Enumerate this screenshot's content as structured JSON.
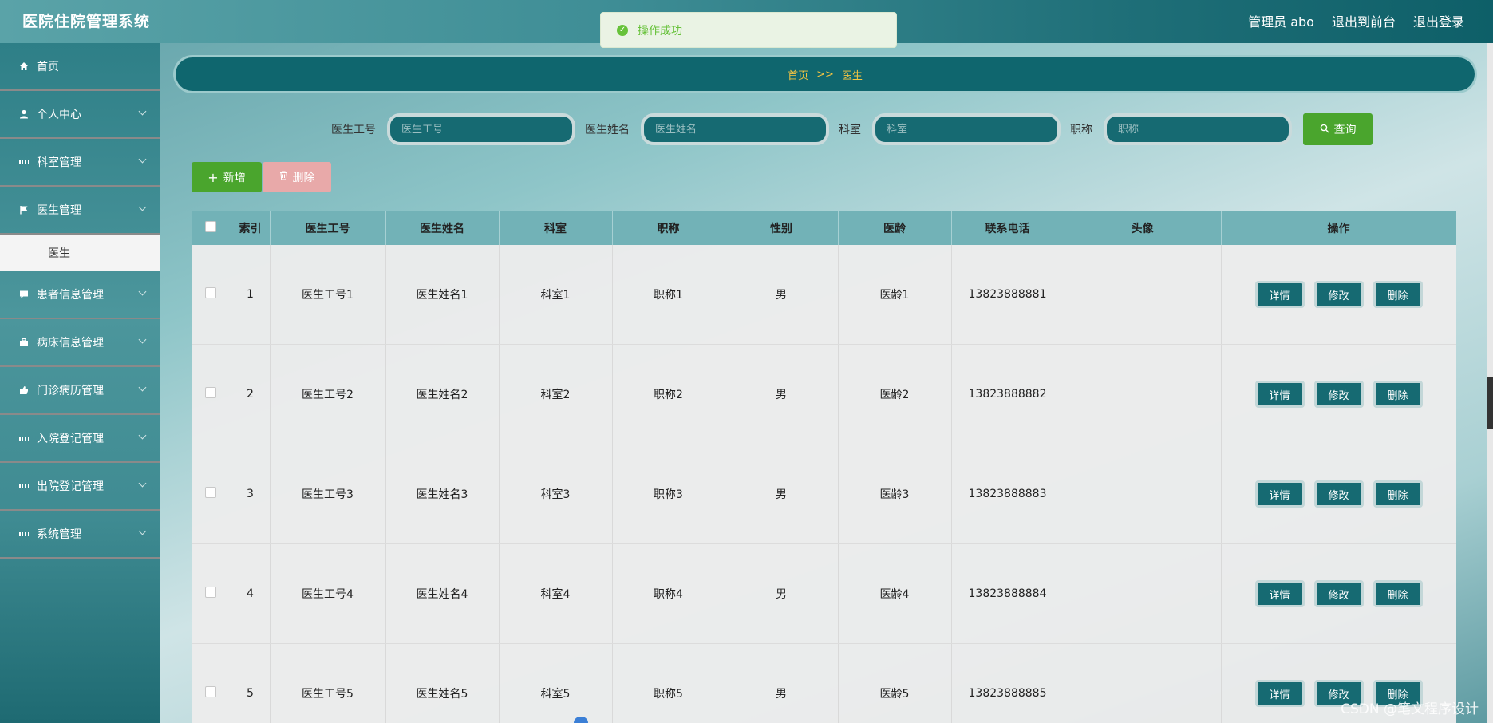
{
  "app": {
    "title": "医院住院管理系统"
  },
  "header": {
    "user_label": "管理员 abo",
    "back_front": "退出到前台",
    "logout": "退出登录"
  },
  "toast": {
    "message": "操作成功"
  },
  "sidebar": {
    "items": [
      {
        "label": "首页",
        "icon": "home-icon"
      },
      {
        "label": "个人中心",
        "icon": "user-icon"
      },
      {
        "label": "科室管理",
        "icon": "grid-icon"
      },
      {
        "label": "医生管理",
        "icon": "flag-icon"
      },
      {
        "label": "患者信息管理",
        "icon": "chat-icon"
      },
      {
        "label": "病床信息管理",
        "icon": "briefcase-icon"
      },
      {
        "label": "门诊病历管理",
        "icon": "thumb-icon"
      },
      {
        "label": "入院登记管理",
        "icon": "grid-icon"
      },
      {
        "label": "出院登记管理",
        "icon": "grid-icon"
      },
      {
        "label": "系统管理",
        "icon": "grid-icon"
      }
    ],
    "submenu": {
      "label": "医生"
    }
  },
  "breadcrumb": {
    "home": "首页",
    "separator": ">>",
    "current": "医生"
  },
  "search": {
    "fields": [
      {
        "label": "医生工号",
        "placeholder": "医生工号"
      },
      {
        "label": "医生姓名",
        "placeholder": "医生姓名"
      },
      {
        "label": "科室",
        "placeholder": "科室"
      },
      {
        "label": "职称",
        "placeholder": "职称"
      }
    ],
    "query_label": "查询"
  },
  "toolbar": {
    "add_label": "新增",
    "delete_label": "删除"
  },
  "table": {
    "headers": [
      "索引",
      "医生工号",
      "医生姓名",
      "科室",
      "职称",
      "性别",
      "医龄",
      "联系电话",
      "头像",
      "操作"
    ],
    "rows": [
      {
        "index": "1",
        "id": "医生工号1",
        "name": "医生姓名1",
        "dept": "科室1",
        "title": "职称1",
        "gender": "男",
        "years": "医龄1",
        "phone": "13823888881"
      },
      {
        "index": "2",
        "id": "医生工号2",
        "name": "医生姓名2",
        "dept": "科室2",
        "title": "职称2",
        "gender": "男",
        "years": "医龄2",
        "phone": "13823888882"
      },
      {
        "index": "3",
        "id": "医生工号3",
        "name": "医生姓名3",
        "dept": "科室3",
        "title": "职称3",
        "gender": "男",
        "years": "医龄3",
        "phone": "13823888883"
      },
      {
        "index": "4",
        "id": "医生工号4",
        "name": "医生姓名4",
        "dept": "科室4",
        "title": "职称4",
        "gender": "男",
        "years": "医龄4",
        "phone": "13823888884"
      },
      {
        "index": "5",
        "id": "医生工号5",
        "name": "医生姓名5",
        "dept": "科室5",
        "title": "职称5",
        "gender": "男",
        "years": "医龄5",
        "phone": "13823888885"
      }
    ],
    "actions": {
      "detail": "详情",
      "edit": "修改",
      "delete": "删除"
    }
  },
  "watermark": "CSDN @笔文程序设计"
}
